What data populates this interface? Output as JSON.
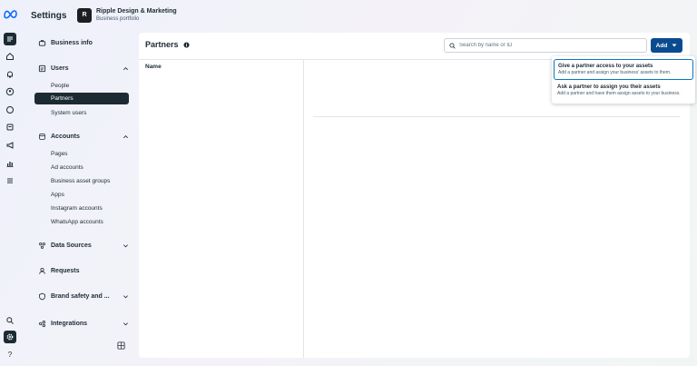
{
  "header": {
    "title": "Settings",
    "portfolio_name": "Ripple Design & Marketing",
    "portfolio_subtitle": "Business portfolio"
  },
  "rail": {
    "icons": [
      "menu-icon",
      "home-icon",
      "bell-icon",
      "account-icon",
      "chat-icon",
      "orders-icon",
      "megaphone-icon",
      "analytics-icon",
      "hamburger-icon",
      "search-icon",
      "gear-icon",
      "help-icon"
    ],
    "active": "gear-icon"
  },
  "sidebar": {
    "business_info": "Business info",
    "users": {
      "label": "Users",
      "items": [
        "People",
        "Partners",
        "System users"
      ],
      "active": "Partners"
    },
    "accounts": {
      "label": "Accounts",
      "items": [
        "Pages",
        "Ad accounts",
        "Business asset groups",
        "Apps",
        "Instagram accounts",
        "WhatsApp accounts"
      ]
    },
    "data_sources": "Data Sources",
    "requests": "Requests",
    "brand_safety": "Brand safety and ...",
    "integrations": "Integrations"
  },
  "main": {
    "title": "Partners",
    "search_placeholder": "Search by name or ID",
    "add_label": "Add",
    "name_column": "Name"
  },
  "dropdown": {
    "items": [
      {
        "title": "Give a partner access to your assets",
        "description": "Add a partner and assign your business' assets to them.",
        "selected": true
      },
      {
        "title": "Ask a partner to assign you their assets",
        "description": "Add a partner and have them assign assets to your business.",
        "selected": false
      }
    ]
  },
  "colors": {
    "primary": "#0a4b8f",
    "active_nav": "#1c2b33",
    "focus_border": "#0a78be"
  }
}
